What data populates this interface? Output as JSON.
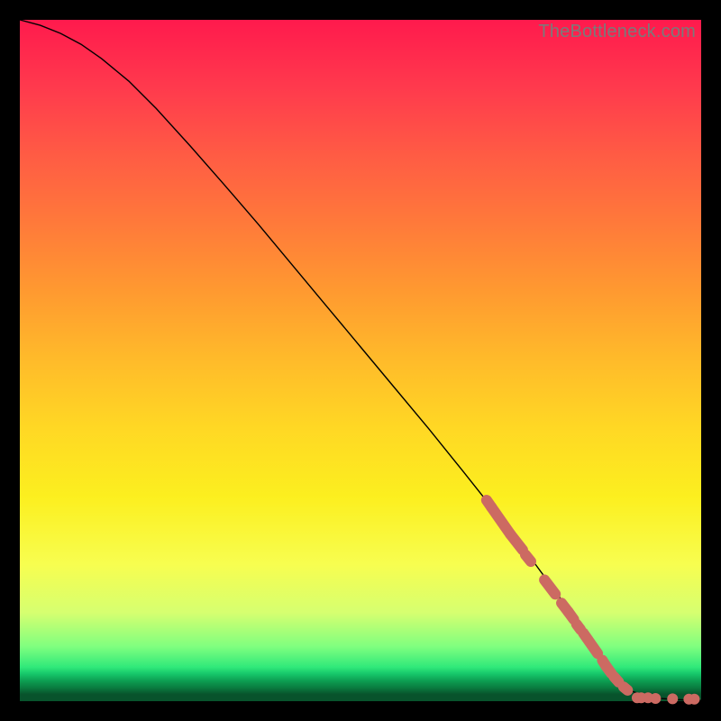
{
  "watermark": "TheBottleneck.com",
  "colors": {
    "curve": "#000000",
    "markers_fill": "#cc6a62",
    "markers_stroke": "#b85a53"
  },
  "chart_data": {
    "type": "line",
    "title": "",
    "xlabel": "",
    "ylabel": "",
    "xlim": [
      0,
      100
    ],
    "ylim": [
      0,
      100
    ],
    "curve": {
      "x": [
        0,
        3,
        6,
        9,
        12,
        16,
        20,
        25,
        30,
        35,
        40,
        45,
        50,
        55,
        60,
        65,
        70,
        75,
        80,
        84,
        86,
        88,
        90,
        92,
        94,
        96,
        98,
        100
      ],
      "y": [
        100,
        99.2,
        98.0,
        96.4,
        94.3,
        91.0,
        87.0,
        81.5,
        75.8,
        70.0,
        64.0,
        58.0,
        52.0,
        46.0,
        40.0,
        33.8,
        27.5,
        21.0,
        14.2,
        8.2,
        5.2,
        2.8,
        1.4,
        0.7,
        0.4,
        0.25,
        0.15,
        0.1
      ]
    },
    "segments": [
      {
        "x0": 68.5,
        "y0": 29.5,
        "x1": 69.2,
        "y1": 28.5
      },
      {
        "x0": 69.2,
        "y0": 28.5,
        "x1": 72.0,
        "y1": 24.5
      },
      {
        "x0": 72.0,
        "y0": 24.5,
        "x1": 73.8,
        "y1": 22.2
      },
      {
        "x0": 74.2,
        "y0": 21.5,
        "x1": 75.0,
        "y1": 20.5
      },
      {
        "x0": 77.0,
        "y0": 17.8,
        "x1": 78.6,
        "y1": 15.7
      },
      {
        "x0": 79.5,
        "y0": 14.4,
        "x1": 80.5,
        "y1": 13.1
      },
      {
        "x0": 80.5,
        "y0": 13.1,
        "x1": 81.3,
        "y1": 12.0
      },
      {
        "x0": 81.7,
        "y0": 11.3,
        "x1": 82.3,
        "y1": 10.5
      },
      {
        "x0": 82.7,
        "y0": 10.0,
        "x1": 84.8,
        "y1": 7.0
      },
      {
        "x0": 85.5,
        "y0": 6.0,
        "x1": 86.0,
        "y1": 5.2
      },
      {
        "x0": 86.0,
        "y0": 5.2,
        "x1": 86.8,
        "y1": 4.1
      },
      {
        "x0": 87.2,
        "y0": 3.6,
        "x1": 87.9,
        "y1": 2.8
      },
      {
        "x0": 88.6,
        "y0": 2.1,
        "x1": 89.2,
        "y1": 1.6
      }
    ],
    "points": [
      {
        "x": 90.6,
        "y": 0.5
      },
      {
        "x": 91.2,
        "y": 0.5
      },
      {
        "x": 92.2,
        "y": 0.5
      },
      {
        "x": 93.3,
        "y": 0.4
      },
      {
        "x": 95.8,
        "y": 0.35
      },
      {
        "x": 98.2,
        "y": 0.3
      },
      {
        "x": 99.0,
        "y": 0.3
      }
    ]
  }
}
